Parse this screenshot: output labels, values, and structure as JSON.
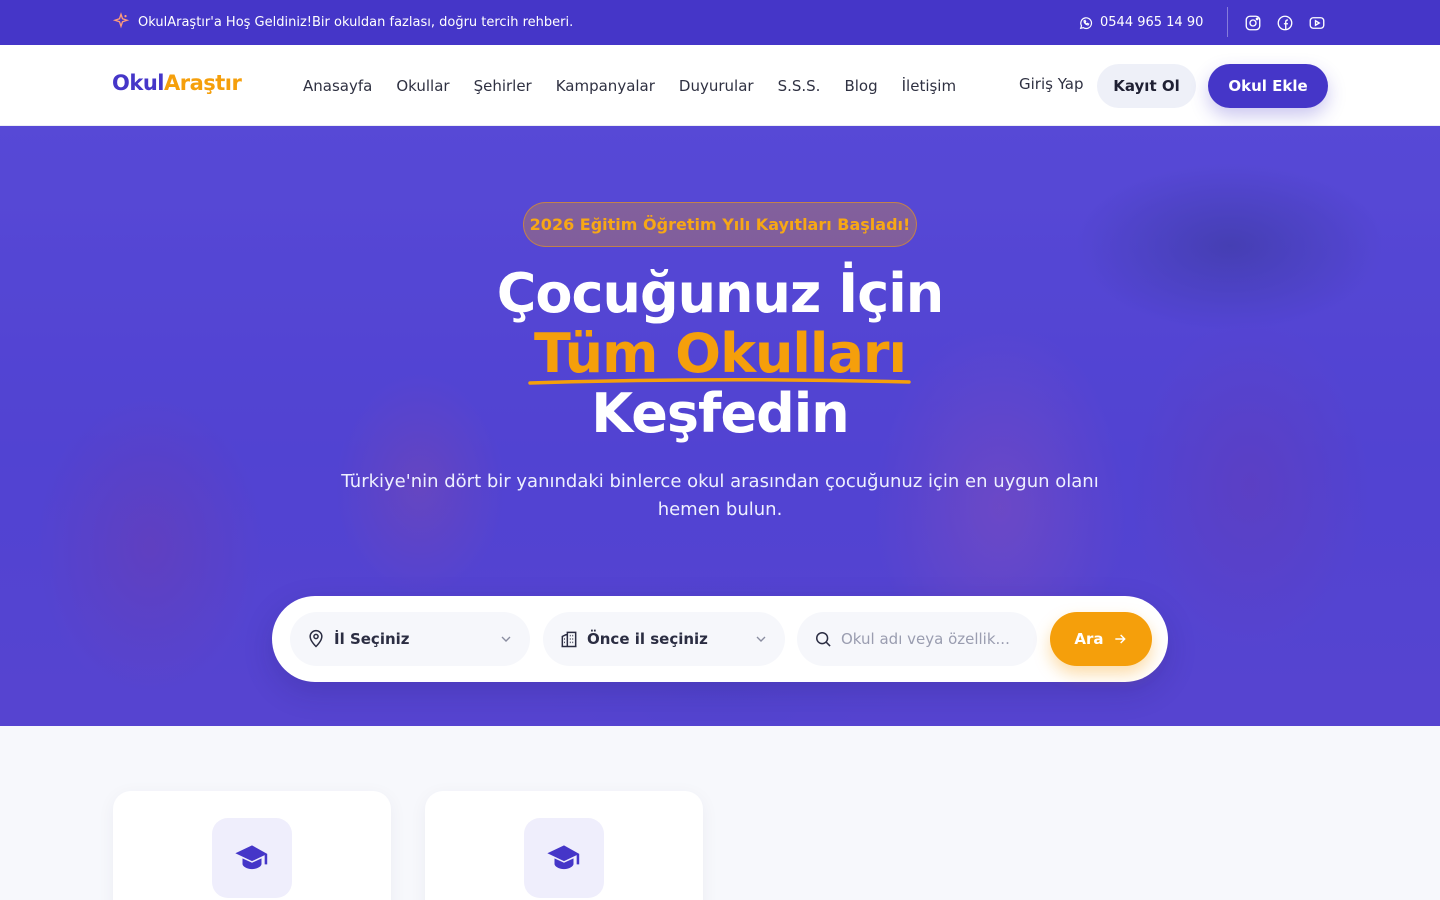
{
  "topbar": {
    "welcome": "OkulAraştır'a Hoş Geldiniz!Bir okuldan fazlası, doğru tercih rehberi.",
    "phone": "0544 965 14 90",
    "social": [
      "instagram-icon",
      "facebook-icon",
      "youtube-icon"
    ]
  },
  "nav": {
    "logo_part1": "Okul",
    "logo_part2": "Araştır",
    "links": [
      "Anasayfa",
      "Okullar",
      "Şehirler",
      "Kampanyalar",
      "Duyurular",
      "S.S.S.",
      "Blog",
      "İletişim"
    ],
    "login": "Giriş Yap",
    "register": "Kayıt Ol",
    "add_school": "Okul Ekle"
  },
  "hero": {
    "badge": "2026 Eğitim Öğretim Yılı Kayıtları Başladı!",
    "title_line1": "Çocuğunuz İçin",
    "title_line2": "Tüm Okulları",
    "title_line3": "Keşfedin",
    "subtitle": "Türkiye'nin dört bir yanındaki binlerce okul arasından çocuğunuz için en uygun olanı hemen bulun."
  },
  "search": {
    "city": "İl Seçiniz",
    "district": "Önce il seçiniz",
    "query_placeholder": "Okul adı veya özellik...",
    "button": "Ara"
  },
  "colors": {
    "primary": "#4536c8",
    "accent": "#f59f0b"
  }
}
